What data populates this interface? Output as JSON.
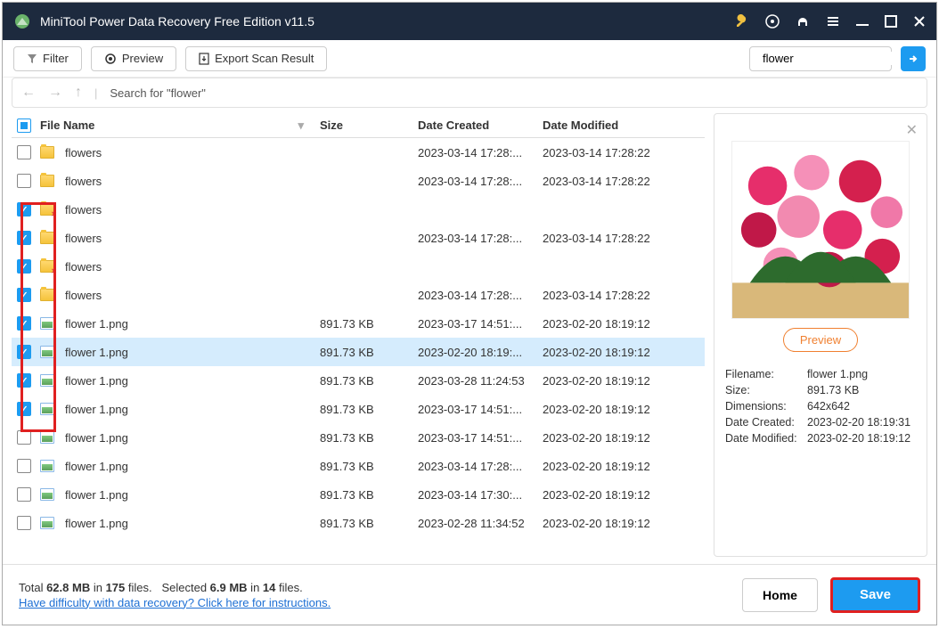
{
  "title": "MiniTool Power Data Recovery Free Edition v11.5",
  "toolbar": {
    "filter": "Filter",
    "preview": "Preview",
    "export": "Export Scan Result"
  },
  "search": {
    "value": "flower"
  },
  "breadcrumb": "Search for  \"flower\"",
  "columns": {
    "name": "File Name",
    "size": "Size",
    "dc": "Date Created",
    "dm": "Date Modified"
  },
  "rows": [
    {
      "checked": false,
      "type": "folder",
      "name": "flowers",
      "size": "",
      "dc": "2023-03-14 17:28:...",
      "dm": "2023-03-14 17:28:22"
    },
    {
      "checked": false,
      "type": "folder",
      "name": "flowers",
      "size": "",
      "dc": "2023-03-14 17:28:...",
      "dm": "2023-03-14 17:28:22"
    },
    {
      "checked": true,
      "type": "folder-del",
      "name": "flowers",
      "size": "",
      "dc": "",
      "dm": ""
    },
    {
      "checked": true,
      "type": "folder",
      "name": "flowers",
      "size": "",
      "dc": "2023-03-14 17:28:...",
      "dm": "2023-03-14 17:28:22"
    },
    {
      "checked": true,
      "type": "folder-del",
      "name": "flowers",
      "size": "",
      "dc": "",
      "dm": ""
    },
    {
      "checked": true,
      "type": "folder",
      "name": "flowers",
      "size": "",
      "dc": "2023-03-14 17:28:...",
      "dm": "2023-03-14 17:28:22"
    },
    {
      "checked": true,
      "type": "img",
      "name": "flower 1.png",
      "size": "891.73 KB",
      "dc": "2023-03-17 14:51:...",
      "dm": "2023-02-20 18:19:12"
    },
    {
      "checked": true,
      "type": "img",
      "name": "flower 1.png",
      "size": "891.73 KB",
      "dc": "2023-02-20 18:19:...",
      "dm": "2023-02-20 18:19:12",
      "selected": true
    },
    {
      "checked": true,
      "type": "img",
      "name": "flower 1.png",
      "size": "891.73 KB",
      "dc": "2023-03-28 11:24:53",
      "dm": "2023-02-20 18:19:12"
    },
    {
      "checked": true,
      "type": "img",
      "name": "flower 1.png",
      "size": "891.73 KB",
      "dc": "2023-03-17 14:51:...",
      "dm": "2023-02-20 18:19:12"
    },
    {
      "checked": false,
      "type": "img",
      "name": "flower 1.png",
      "size": "891.73 KB",
      "dc": "2023-03-17 14:51:...",
      "dm": "2023-02-20 18:19:12"
    },
    {
      "checked": false,
      "type": "img",
      "name": "flower 1.png",
      "size": "891.73 KB",
      "dc": "2023-03-14 17:28:...",
      "dm": "2023-02-20 18:19:12"
    },
    {
      "checked": false,
      "type": "img",
      "name": "flower 1.png",
      "size": "891.73 KB",
      "dc": "2023-03-14 17:30:...",
      "dm": "2023-02-20 18:19:12"
    },
    {
      "checked": false,
      "type": "img",
      "name": "flower 1.png",
      "size": "891.73 KB",
      "dc": "2023-02-28 11:34:52",
      "dm": "2023-02-20 18:19:12"
    }
  ],
  "preview": {
    "btn": "Preview",
    "meta": {
      "filename_l": "Filename:",
      "filename_v": "flower 1.png",
      "size_l": "Size:",
      "size_v": "891.73 KB",
      "dim_l": "Dimensions:",
      "dim_v": "642x642",
      "dc_l": "Date Created:",
      "dc_v": "2023-02-20 18:19:31",
      "dm_l": "Date Modified:",
      "dm_v": "2023-02-20 18:19:12"
    }
  },
  "footer": {
    "total_pre": "Total ",
    "total_size": "62.8 MB",
    "total_mid": " in ",
    "total_files": "175",
    "total_suf": " files.",
    "sel_pre": "Selected ",
    "sel_size": "6.9 MB",
    "sel_mid": " in ",
    "sel_files": "14",
    "sel_suf": " files.",
    "help": "Have difficulty with data recovery? Click here for instructions.",
    "home": "Home",
    "save": "Save"
  }
}
